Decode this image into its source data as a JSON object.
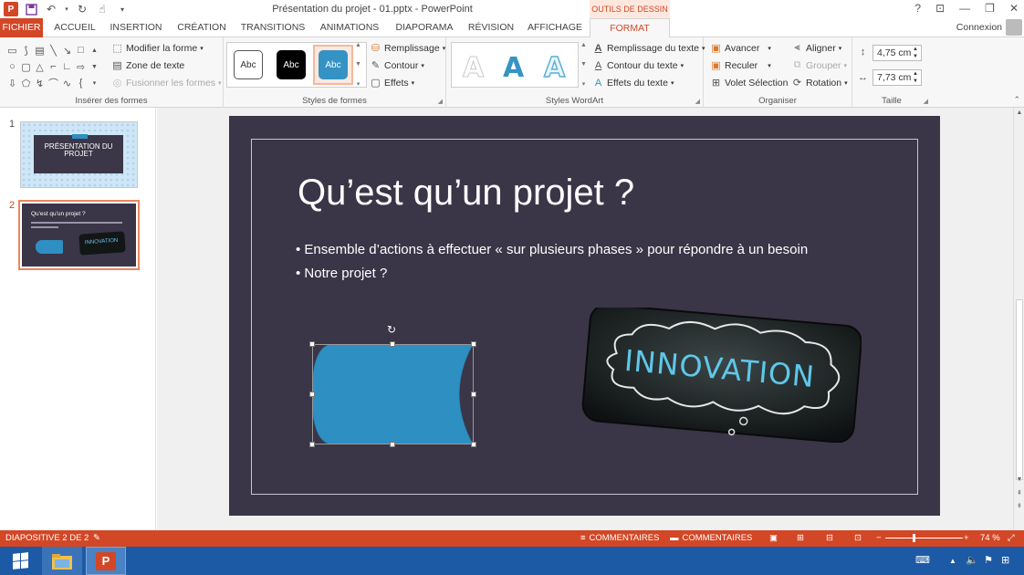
{
  "app": {
    "doc_title": "Présentation du projet - 01.pptx - PowerPoint",
    "context_group": "OUTILS DE DESSIN",
    "connexion": "Connexion"
  },
  "tabs": [
    "FICHIER",
    "ACCUEIL",
    "INSERTION",
    "CRÉATION",
    "TRANSITIONS",
    "ANIMATIONS",
    "DIAPORAMA",
    "RÉVISION",
    "AFFICHAGE",
    "FORMAT"
  ],
  "ribbon": {
    "insert_shapes": {
      "modify_shape": "Modifier la forme",
      "text_box": "Zone de texte",
      "merge_shapes": "Fusionner les formes",
      "label": "Insérer des formes"
    },
    "shape_styles": {
      "swatch": "Abc",
      "fill": "Remplissage",
      "outline": "Contour",
      "effects": "Effets",
      "label": "Styles de formes"
    },
    "wordart": {
      "letter": "A",
      "text_fill": "Remplissage du texte",
      "text_outline": "Contour du texte",
      "text_effects": "Effets du texte",
      "label": "Styles WordArt"
    },
    "arrange": {
      "forward": "Avancer",
      "backward": "Reculer",
      "selection_pane": "Volet Sélection",
      "align": "Aligner",
      "group": "Grouper",
      "rotate": "Rotation",
      "label": "Organiser"
    },
    "size": {
      "height": "4,75 cm",
      "width": "7,73 cm",
      "label": "Taille"
    }
  },
  "thumbnails": [
    {
      "num": "1",
      "title_line1": "PRÉSENTATION DU",
      "title_line2": "PROJET"
    },
    {
      "num": "2",
      "title": "Qu'est qu'un projet ?",
      "image_text": "INNOVATION"
    }
  ],
  "slide": {
    "title": "Qu’est qu’un projet ?",
    "bullets": [
      "Ensemble d’actions à effectuer « sur plusieurs phases » pour répondre à un besoin",
      "Notre projet ?"
    ],
    "image_text": "INNOVATION"
  },
  "statusbar": {
    "slide_info": "DIAPOSITIVE 2 DE 2",
    "notes": "COMMENTAIRES",
    "comments": "COMMENTAIRES",
    "zoom": "74 %"
  },
  "colors": {
    "accent": "#d24726",
    "slide_bg": "#3a3547",
    "shape_fill": "#2e8fc2",
    "taskbar": "#1d5aa6"
  }
}
